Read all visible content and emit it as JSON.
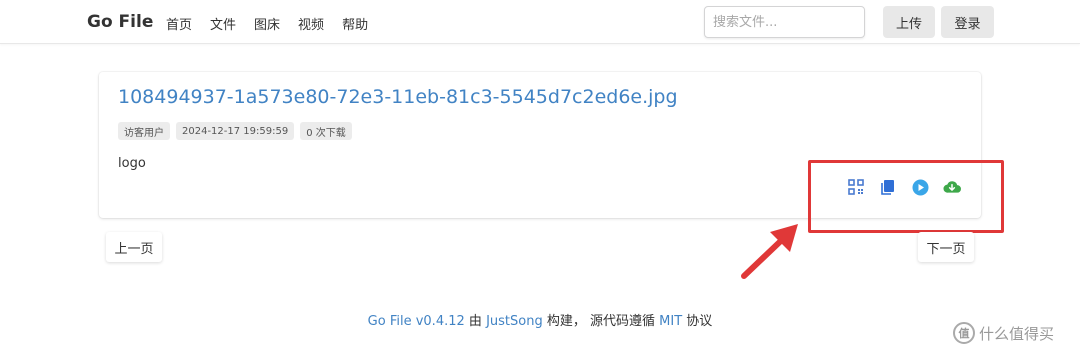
{
  "header": {
    "brand": "Go File",
    "nav": [
      "首页",
      "文件",
      "图床",
      "视频",
      "帮助"
    ],
    "search_placeholder": "搜索文件...",
    "upload_label": "上传",
    "login_label": "登录"
  },
  "file": {
    "name": "108494937-1a573e80-72e3-11eb-81c3-5545d7c2ed6e.jpg",
    "uploader": "访客用户",
    "time": "2024-12-17 19:59:59",
    "downloads": "0 次下载",
    "description": "logo",
    "actions": [
      "qrcode-icon",
      "copy-icon",
      "play-icon",
      "cloud-download-icon"
    ]
  },
  "pagination": {
    "prev": "上一页",
    "next": "下一页"
  },
  "footer": {
    "app": "Go File v0.4.12",
    "by": "由",
    "author": "JustSong",
    "built": "构建，",
    "source_text": "源代码遵循",
    "license": "MIT",
    "agreement": "协议"
  },
  "watermark": {
    "badge": "值",
    "text": "什么值得买"
  },
  "colors": {
    "link": "#4183c4",
    "highlight": "#e03838",
    "qr": "#4a7bd0",
    "copy": "#2f6fd6",
    "play": "#3aa6e8",
    "download": "#3ea84a"
  }
}
